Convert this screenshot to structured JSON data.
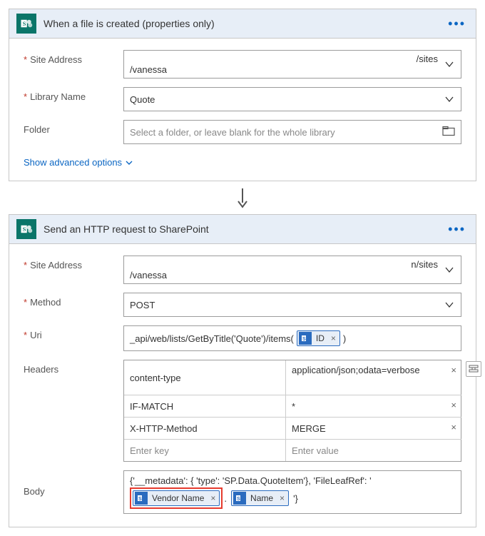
{
  "card1": {
    "title": "When a file is created (properties only)",
    "siteAddress": {
      "label": "Site Address",
      "line1": "/sites",
      "line2": "/vanessa"
    },
    "libraryName": {
      "label": "Library Name",
      "value": "Quote"
    },
    "folder": {
      "label": "Folder",
      "placeholder": "Select a folder, or leave blank for the whole library"
    },
    "advanced": "Show advanced options"
  },
  "card2": {
    "title": "Send an HTTP request to SharePoint",
    "siteAddress": {
      "label": "Site Address",
      "line1": "n/sites",
      "line2": "/vanessa"
    },
    "method": {
      "label": "Method",
      "value": "POST"
    },
    "uri": {
      "label": "Uri",
      "prefix": "_api/web/lists/GetByTitle('Quote')/items(",
      "token": "ID",
      "suffix": ")"
    },
    "headers": {
      "label": "Headers",
      "rows": [
        {
          "key": "content-type",
          "value": "application/json;odata=verbose"
        },
        {
          "key": "IF-MATCH",
          "value": "*"
        },
        {
          "key": "X-HTTP-Method",
          "value": "MERGE"
        }
      ],
      "placeholderKey": "Enter key",
      "placeholderValue": "Enter value"
    },
    "body": {
      "label": "Body",
      "prefix": "{'__metadata': { 'type': 'SP.Data.QuoteItem'}, 'FileLeafRef': '",
      "token1": "Vendor Name",
      "mid": ".",
      "token2": "Name",
      "suffix": "'}"
    }
  }
}
